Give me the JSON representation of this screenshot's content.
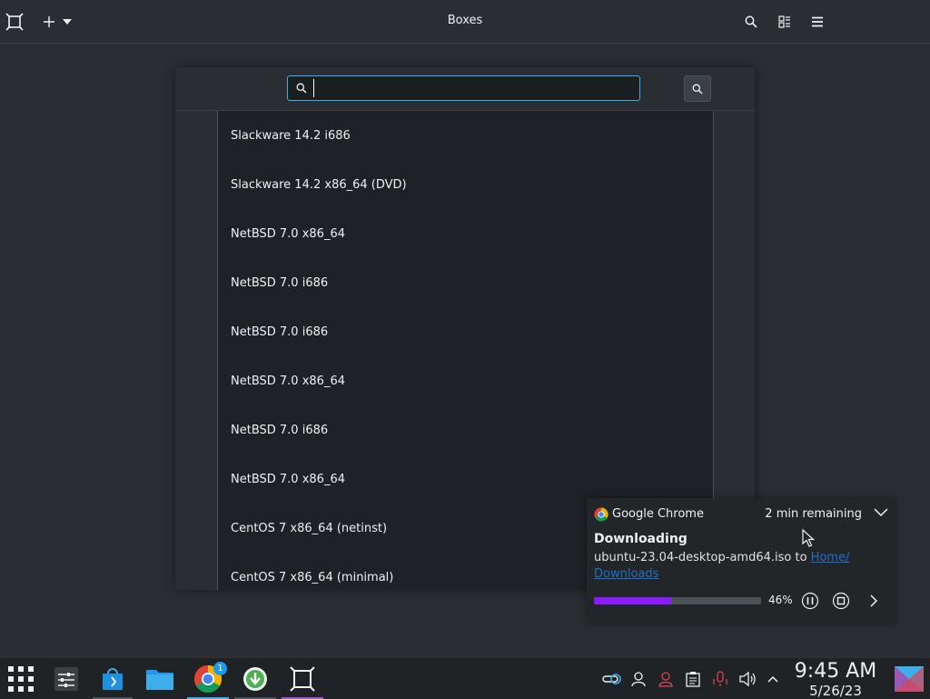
{
  "window": {
    "title": "Boxes"
  },
  "toolbar": {
    "icons": [
      "boxes-logo-icon",
      "add-icon",
      "dropdown-arrow-icon",
      "search-icon",
      "view-toggle-icon",
      "menu-icon"
    ]
  },
  "search": {
    "value": "",
    "placeholder": ""
  },
  "os_list": {
    "items": [
      {
        "label": "Slackware 14.2 i686"
      },
      {
        "label": "Slackware 14.2 x86_64 (DVD)"
      },
      {
        "label": "NetBSD 7.0 x86_64"
      },
      {
        "label": "NetBSD 7.0 i686"
      },
      {
        "label": "NetBSD 7.0 i686"
      },
      {
        "label": "NetBSD 7.0 x86_64"
      },
      {
        "label": "NetBSD 7.0 i686"
      },
      {
        "label": "NetBSD 7.0 x86_64"
      },
      {
        "label": "CentOS 7 x86_64 (netinst)"
      },
      {
        "label": "CentOS 7 x86_64 (minimal)"
      }
    ]
  },
  "notification": {
    "app_name": "Google Chrome",
    "time_remaining": "2 min remaining",
    "heading": "Downloading",
    "filename_text": "ubuntu-23.04-desktop-amd64.iso to ",
    "destination": "Home/ Downloads",
    "progress_percent": 46,
    "progress_label": "46%",
    "accent": "#8c1aff"
  },
  "taskbar": {
    "apps": [
      "app-launcher-icon",
      "mixer-icon",
      "discover-store-icon",
      "file-manager-icon",
      "chrome-icon",
      "downloader-icon",
      "boxes-icon"
    ],
    "chrome_badge": "1",
    "tray": [
      "network-icon",
      "user-icon",
      "user-accounts-icon",
      "clipboard-icon",
      "microphone-muted-icon",
      "volume-icon",
      "tray-expand-icon"
    ],
    "time": "9:45 AM",
    "date": "5/26/23"
  }
}
